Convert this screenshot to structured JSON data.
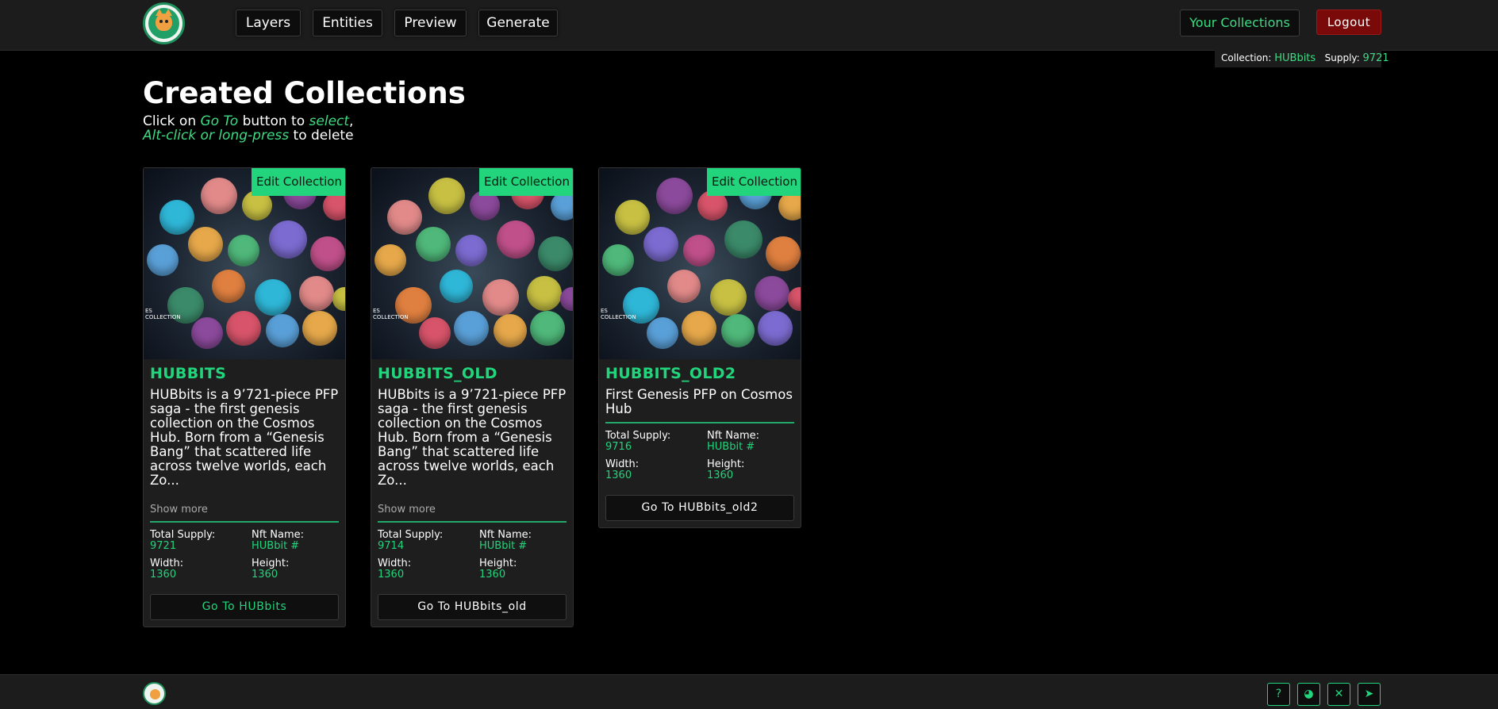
{
  "header": {
    "nav": [
      "Layers",
      "Entities",
      "Preview",
      "Generate"
    ],
    "your_collections": "Your Collections",
    "logout": "Logout",
    "collection_label": "Collection:",
    "collection_value": "HUBbits",
    "supply_label": "Supply:",
    "supply_value": "9721"
  },
  "page": {
    "title": "Created Collections",
    "sub_prefix": "Click on ",
    "sub_goto": "Go To",
    "sub_mid": " button to ",
    "sub_select": "select",
    "sub_comma": ",",
    "sub_alt": "Alt-click or long-press",
    "sub_delete": " to delete"
  },
  "cards": [
    {
      "edit": "Edit Collection",
      "name": "HUBBITS",
      "desc": "HUBbits is a 9’721-piece PFP saga - the first genesis collection on the Cosmos Hub. Born from a “Genesis Bang” that scattered life across twelve worlds, each Zo...",
      "show_more": "Show more",
      "total_supply_label": "Total Supply:",
      "total_supply": "9721",
      "nft_name_label": "Nft Name:",
      "nft_name": "HUBbit #",
      "width_label": "Width:",
      "width": "1360",
      "height_label": "Height:",
      "height": "1360",
      "goto": "Go To HUBbits"
    },
    {
      "edit": "Edit Collection",
      "name": "HUBBITS_OLD",
      "desc": "HUBbits is a 9’721-piece PFP saga - the first genesis collection on the Cosmos Hub. Born from a “Genesis Bang” that scattered life across twelve worlds, each Zo...",
      "show_more": "Show more",
      "total_supply_label": "Total Supply:",
      "total_supply": "9714",
      "nft_name_label": "Nft Name:",
      "nft_name": "HUBbit #",
      "width_label": "Width:",
      "width": "1360",
      "height_label": "Height:",
      "height": "1360",
      "goto": "Go To HUBbits_old"
    },
    {
      "edit": "Edit Collection",
      "name": "HUBBITS_OLD2",
      "desc": "First Genesis PFP on Cosmos Hub",
      "total_supply_label": "Total Supply:",
      "total_supply": "9716",
      "nft_name_label": "Nft Name:",
      "nft_name": "HUBbit #",
      "width_label": "Width:",
      "width": "1360",
      "height_label": "Height:",
      "height": "1360",
      "goto": "Go To HUBbits_old2"
    }
  ],
  "image_overlay_text": "ES COLLECTION",
  "footer_icons": [
    "help-icon",
    "discord-icon",
    "x-icon",
    "telegram-icon"
  ],
  "colors": {
    "accent": "#22d47c",
    "logout": "#7a0a0a",
    "panel": "#1e1e1e"
  }
}
